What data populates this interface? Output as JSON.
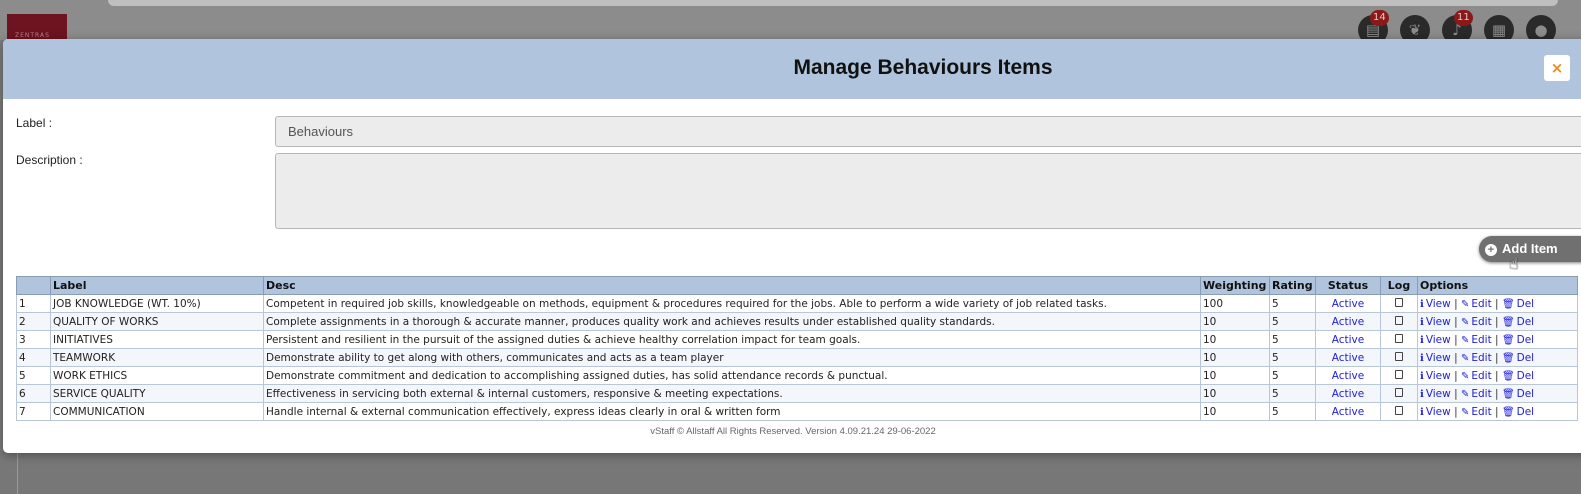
{
  "header_icons": {
    "news_badge": "14",
    "notification_badge": "11"
  },
  "modal": {
    "title": "Manage Behaviours Items",
    "close_label": "×"
  },
  "form": {
    "label_caption": "Label :",
    "label_value": "Behaviours",
    "description_caption": "Description :",
    "description_value": ""
  },
  "add_button": {
    "label": "Add Item"
  },
  "table": {
    "headers": [
      "",
      "Label",
      "Desc",
      "Weighting",
      "Rating",
      "Status",
      "Log",
      "Options"
    ],
    "option_labels": {
      "view": "View",
      "edit": "Edit",
      "del": "Del",
      "sep": "|"
    },
    "rows": [
      {
        "no": "1",
        "label": "JOB KNOWLEDGE (WT. 10%)",
        "desc": "Competent in required job skills, knowledgeable on methods, equipment & procedures required for the jobs. Able to perform a wide variety of job related tasks.",
        "weighting": "100",
        "rating": "5",
        "status": "Active"
      },
      {
        "no": "2",
        "label": "QUALITY OF WORKS",
        "desc": "Complete assignments in a thorough & accurate manner, produces quality work and achieves results under established quality standards.",
        "weighting": "10",
        "rating": "5",
        "status": "Active"
      },
      {
        "no": "3",
        "label": "INITIATIVES",
        "desc": "Persistent and resilient in the pursuit of the assigned duties & achieve healthy correlation impact for team goals.",
        "weighting": "10",
        "rating": "5",
        "status": "Active"
      },
      {
        "no": "4",
        "label": "TEAMWORK",
        "desc": "Demonstrate ability to get along with others, communicates and acts as a team player",
        "weighting": "10",
        "rating": "5",
        "status": "Active"
      },
      {
        "no": "5",
        "label": "WORK ETHICS",
        "desc": "Demonstrate commitment and dedication to accomplishing assigned duties, has solid attendance records & punctual.",
        "weighting": "10",
        "rating": "5",
        "status": "Active"
      },
      {
        "no": "6",
        "label": "SERVICE QUALITY",
        "desc": "Effectiveness in servicing both external & internal customers, responsive & meeting expectations.",
        "weighting": "10",
        "rating": "5",
        "status": "Active"
      },
      {
        "no": "7",
        "label": "COMMUNICATION",
        "desc": "Handle internal & external communication effectively, express ideas clearly in oral & written form",
        "weighting": "10",
        "rating": "5",
        "status": "Active"
      }
    ]
  },
  "footer": {
    "text": "vStaff © Allstaff All Rights Reserved. Version 4.09.21.24 29-06-2022"
  },
  "colors": {
    "header_bg": "#b0c4de",
    "link": "#2020d8",
    "close": "#ee8a1b"
  }
}
